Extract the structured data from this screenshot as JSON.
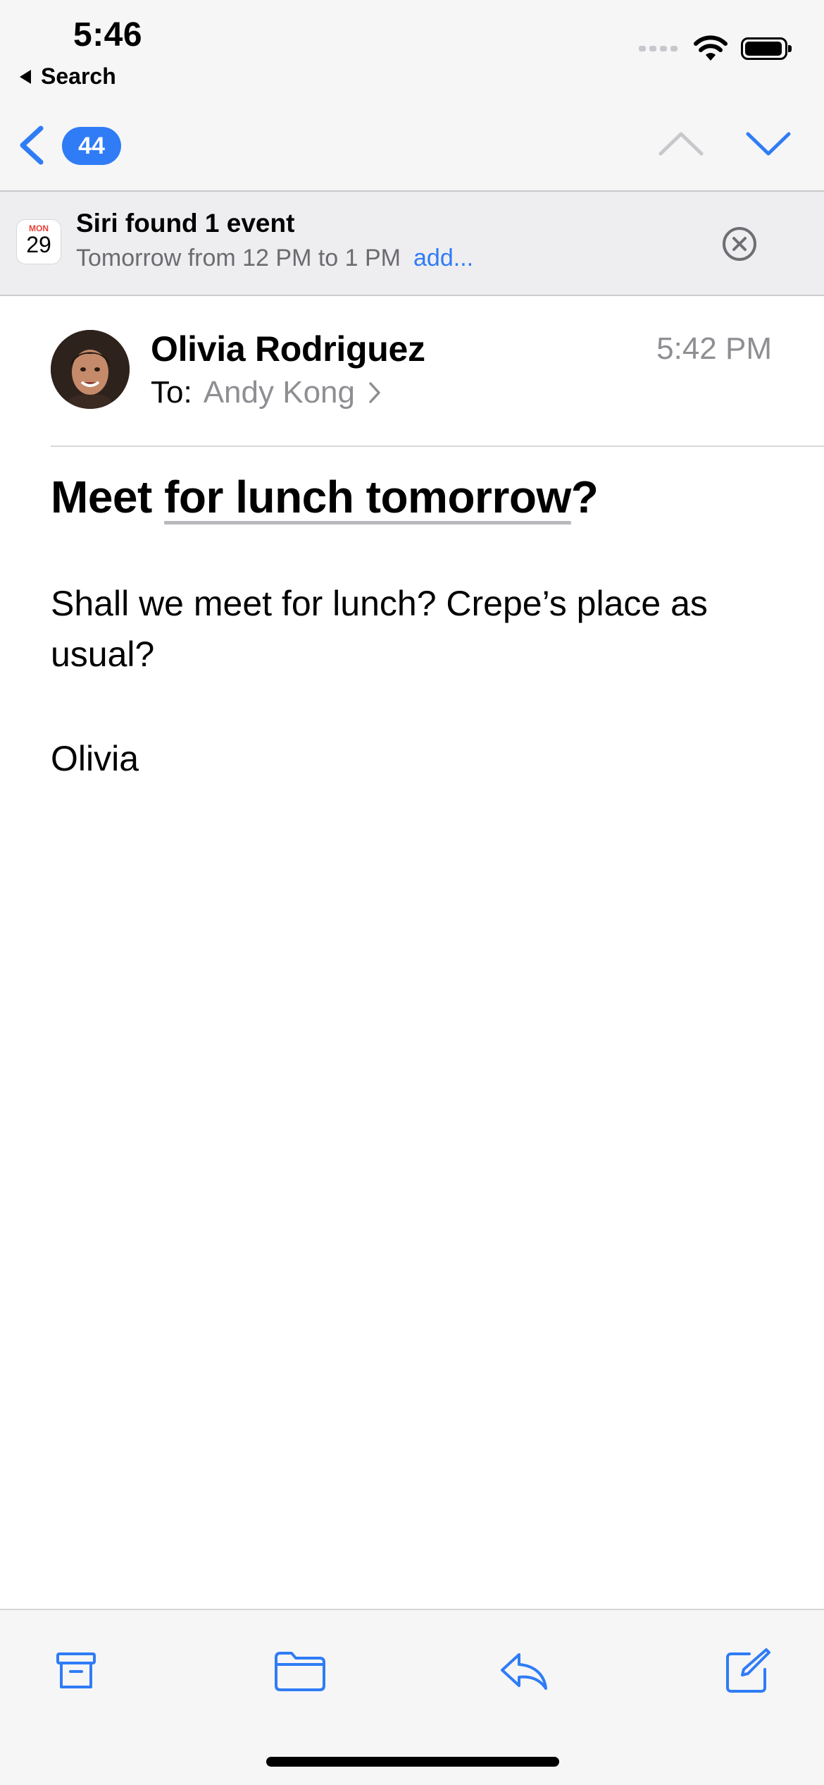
{
  "status_bar": {
    "time": "5:46",
    "back_app": "Search"
  },
  "nav": {
    "unread_count": "44"
  },
  "siri_suggestion": {
    "calendar_month": "MON",
    "calendar_day": "29",
    "title": "Siri found 1 event",
    "detail": "Tomorrow from 12 PM to 1 PM",
    "action": "add..."
  },
  "message": {
    "sender": "Olivia Rodriguez",
    "to_label": "To:",
    "recipient": "Andy Kong",
    "time": "5:42 PM",
    "subject_prefix": "Meet ",
    "subject_detected": "for lunch tomorrow",
    "subject_suffix": "?",
    "body": "Shall we meet for lunch?  Crepe’s place as usual?",
    "signature": "Olivia"
  },
  "colors": {
    "accent": "#2f7cf6",
    "secondary_text": "#8e8e93",
    "toolbar_bg": "#f6f6f7"
  },
  "toolbar": {
    "icons": [
      "archive-icon",
      "folder-icon",
      "reply-icon",
      "compose-icon"
    ]
  }
}
